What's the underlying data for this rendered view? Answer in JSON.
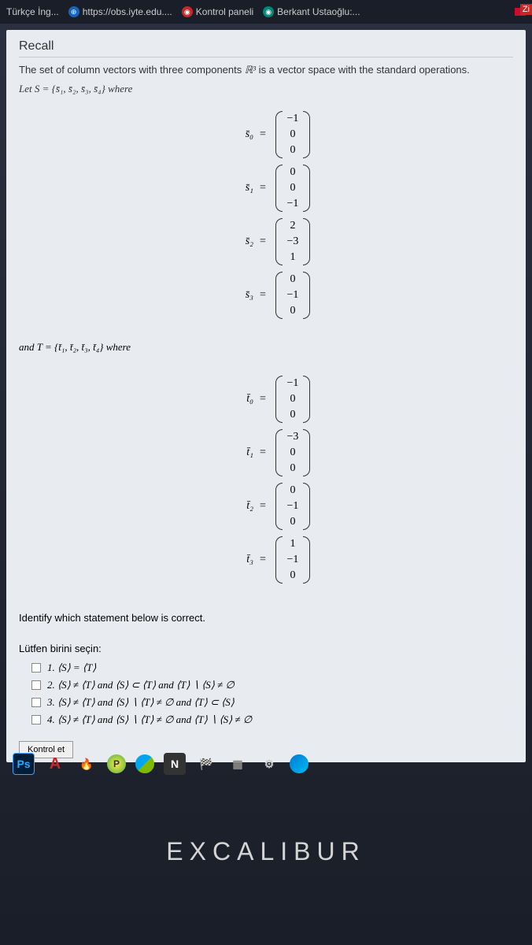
{
  "tabs": {
    "t1": "Türkçe İng...",
    "t2": "https://obs.iyte.edu....",
    "t3": "Kontrol paneli",
    "t4": "Berkant Ustaoğlu:...",
    "zi": "Zi"
  },
  "recall": {
    "title": "Recall",
    "text1_a": "The set of column vectors with three components ",
    "text1_b": " is a vector space with the standard operations.",
    "r3": "ℝ³",
    "let_s": "Let S = {s̄₁, s̄₂, s̄₃, s̄₄} where",
    "and_t": "and T = {t̄₁, t̄₂, t̄₃, t̄₄} where"
  },
  "vectors_s": {
    "s0": {
      "label": "s̄₀",
      "v": [
        "−1",
        "0",
        "0"
      ]
    },
    "s1": {
      "label": "s̄₁",
      "v": [
        "0",
        "0",
        "−1"
      ]
    },
    "s2": {
      "label": "s̄₂",
      "v": [
        "2",
        "−3",
        "1"
      ]
    },
    "s3": {
      "label": "s̄₃",
      "v": [
        "0",
        "−1",
        "0"
      ]
    }
  },
  "vectors_t": {
    "t0": {
      "label": "t̄₀",
      "v": [
        "−1",
        "0",
        "0"
      ]
    },
    "t1": {
      "label": "t̄₁",
      "v": [
        "−3",
        "0",
        "0"
      ]
    },
    "t2": {
      "label": "t̄₂",
      "v": [
        "0",
        "−1",
        "0"
      ]
    },
    "t3": {
      "label": "t̄₃",
      "v": [
        "1",
        "−1",
        "0"
      ]
    }
  },
  "instruction": "Identify which statement below is correct.",
  "question": {
    "prompt": "Lütfen birini seçin:",
    "opt1": "1. ⟨S⟩ = ⟨T⟩",
    "opt2": "2. ⟨S⟩ ≠ ⟨T⟩ and ⟨S⟩ ⊂ ⟨T⟩ and ⟨T⟩ ∖ ⟨S⟩ ≠ ∅",
    "opt3": "3. ⟨S⟩ ≠ ⟨T⟩ and ⟨S⟩ ∖ ⟨T⟩ ≠ ∅ and ⟨T⟩ ⊂ ⟨S⟩",
    "opt4": "4. ⟨S⟩ ≠ ⟨T⟩ and ⟨S⟩ ∖ ⟨T⟩ ≠ ∅ and ⟨T⟩ ∖ ⟨S⟩ ≠ ∅",
    "button": "Kontrol et"
  },
  "taskbar": {
    "ps": "Ps",
    "a": "A",
    "p": "P",
    "n": "N"
  },
  "brand": "EXCALIBUR"
}
